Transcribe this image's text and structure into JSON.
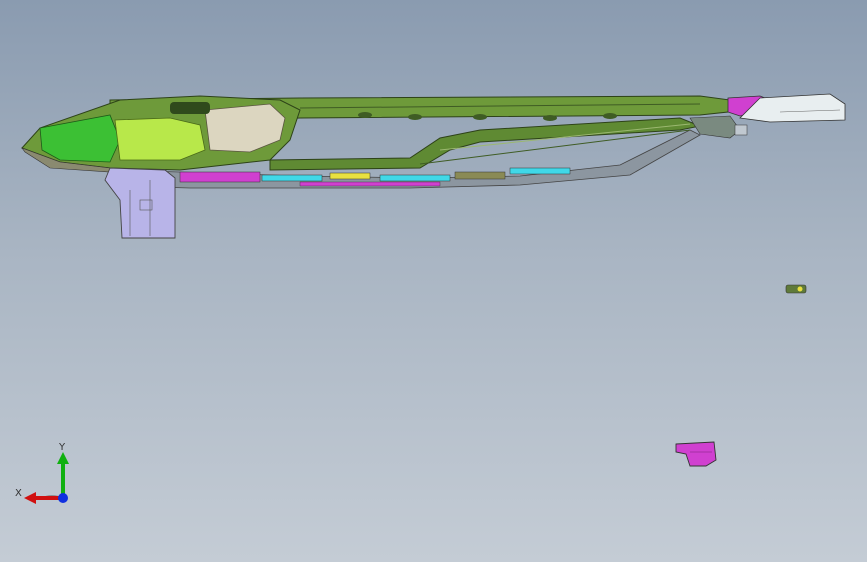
{
  "triad": {
    "x_label": "X",
    "y_label": "Y",
    "x_color": "#d01010",
    "y_color": "#10b010",
    "z_color": "#1030e0"
  },
  "colors": {
    "frame_green": "#6e9a3a",
    "frame_dark": "#3f5c24",
    "light_green": "#a8e045",
    "bright_green": "#34c030",
    "cream": "#dcd6c0",
    "lavender": "#b8b4e8",
    "magenta": "#d040d0",
    "cyan": "#40d8e8",
    "olive": "#8a8a55"
  }
}
